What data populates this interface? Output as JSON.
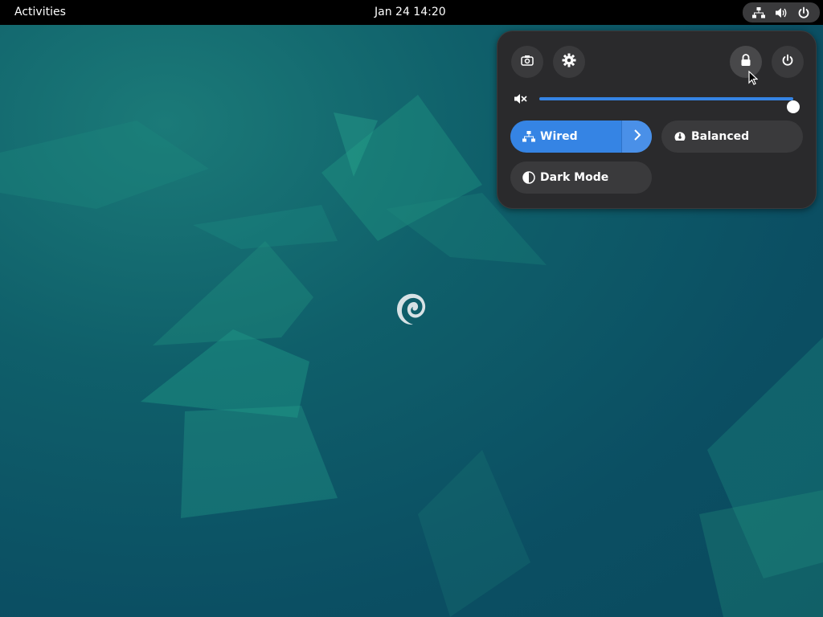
{
  "topbar": {
    "activities_label": "Activities",
    "clock_text": "Jan 24  14:20",
    "tray_icons": [
      "network-wired-icon",
      "volume-icon",
      "power-icon"
    ]
  },
  "quick_settings": {
    "buttons": [
      "screenshot-icon",
      "settings-icon",
      "lock-icon",
      "power-icon"
    ],
    "volume": {
      "icon": "volume-muted-icon",
      "level": 1.0
    },
    "toggles": {
      "wired": {
        "label": "Wired",
        "active": true
      },
      "balanced": {
        "label": "Balanced",
        "active": false
      },
      "dark_mode": {
        "label": "Dark Mode",
        "active": false
      }
    }
  },
  "colors": {
    "accent": "#3584e4",
    "panel_bg": "#2a2a2c",
    "button_bg": "#3a3a3c"
  }
}
